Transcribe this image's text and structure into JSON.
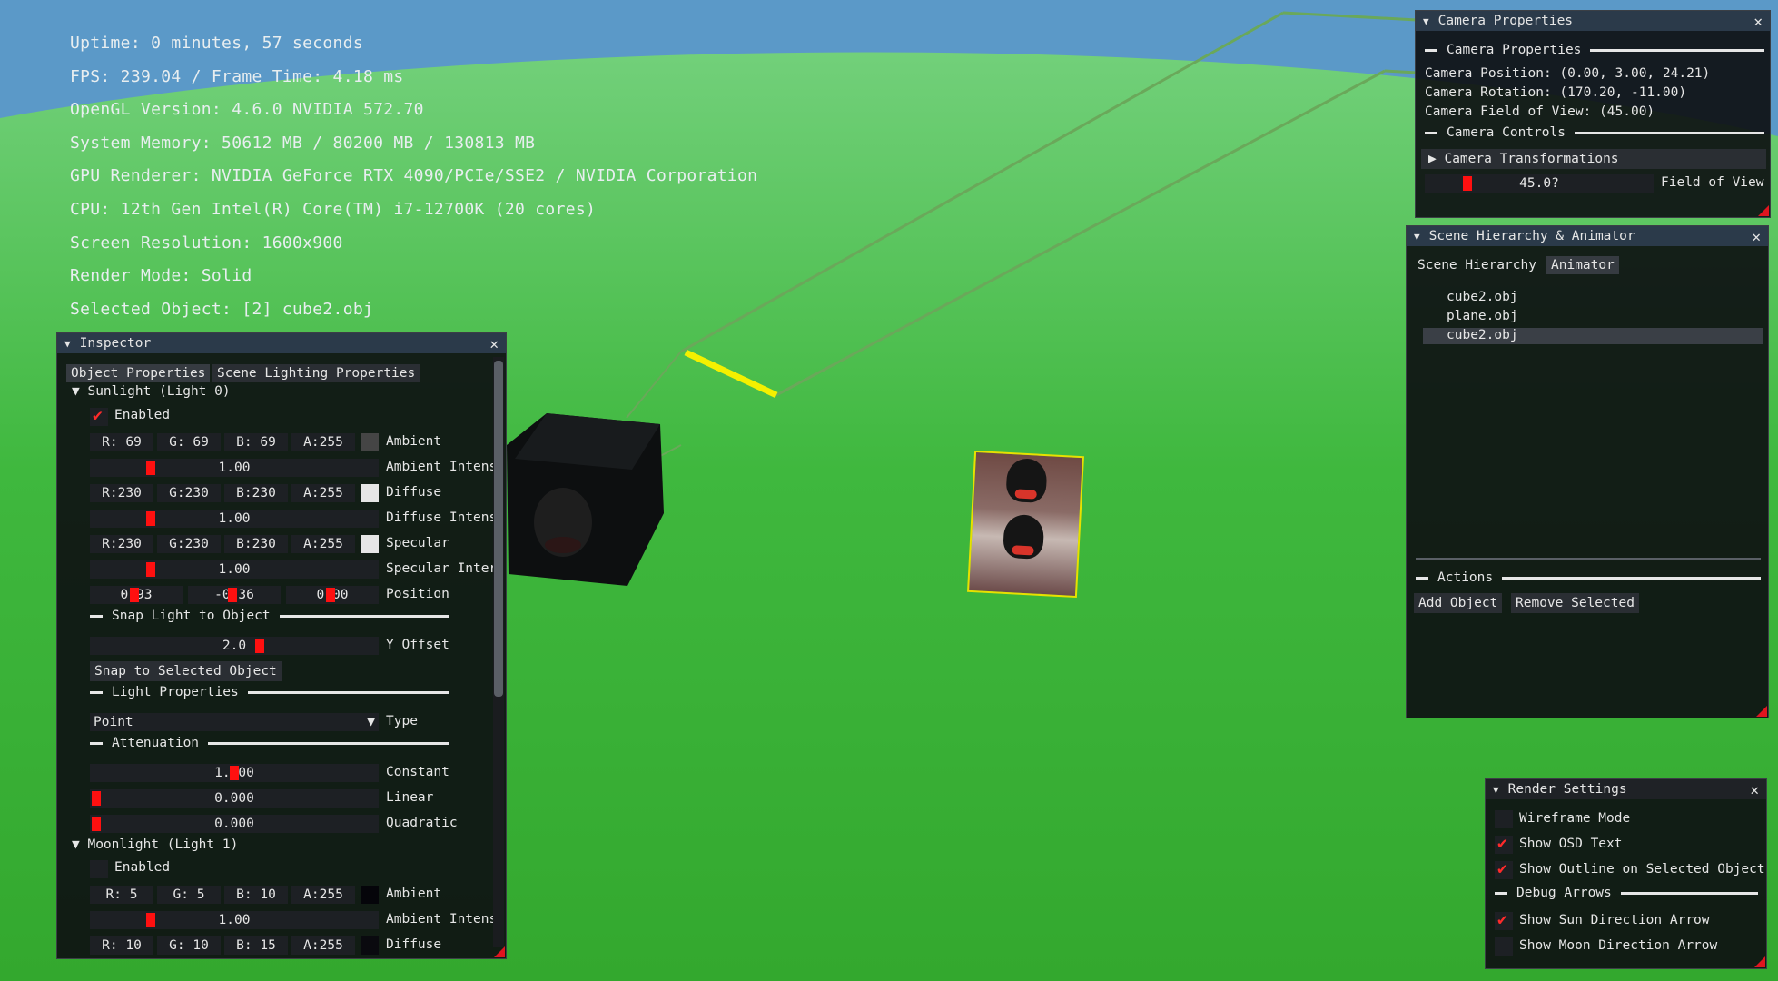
{
  "osd": {
    "lines": [
      "Uptime: 0 minutes, 57 seconds",
      "FPS: 239.04 / Frame Time: 4.18 ms",
      "OpenGL Version: 4.6.0 NVIDIA 572.70",
      "System Memory: 50612 MB / 80200 MB / 130813 MB",
      "GPU Renderer: NVIDIA GeForce RTX 4090/PCIe/SSE2 / NVIDIA Corporation",
      "CPU: 12th Gen Intel(R) Core(TM) i7-12700K (20 cores)",
      "Screen Resolution: 1600x900",
      "Render Mode: Solid",
      "Selected Object: [2] cube2.obj"
    ]
  },
  "colors": {
    "sky": "#5b99c8",
    "ground": "#3cb83c",
    "accent_red": "#ff1010",
    "outline_yellow": "#e8e000",
    "title_active": "#2b3a4a"
  },
  "inspector": {
    "title": "Inspector",
    "tabs": [
      "Object Properties",
      "Scene Lighting Properties"
    ],
    "sun": {
      "header": "Sunlight (Light 0)",
      "enabled_label": "Enabled",
      "enabled": true,
      "ambient": {
        "r": "R: 69",
        "g": "G: 69",
        "b": "B: 69",
        "a": "A:255",
        "label": "Ambient",
        "swatch": "#454545"
      },
      "ambient_intensity": {
        "value": "1.00",
        "label": "Ambient Intens"
      },
      "diffuse": {
        "r": "R:230",
        "g": "G:230",
        "b": "B:230",
        "a": "A:255",
        "label": "Diffuse",
        "swatch": "#e6e6e6"
      },
      "diffuse_intensity": {
        "value": "1.00",
        "label": "Diffuse Intens"
      },
      "specular": {
        "r": "R:230",
        "g": "G:230",
        "b": "B:230",
        "a": "A:255",
        "label": "Specular",
        "swatch": "#e6e6e6"
      },
      "specular_intensity": {
        "value": "1.00",
        "label": "Specular Inter"
      },
      "position": {
        "x": "0.93",
        "y": "-0.36",
        "z": "0.00",
        "label": "Position"
      },
      "snap_header": "Snap Light to Object",
      "y_offset": {
        "value": "2.0",
        "label": "Y Offset"
      },
      "snap_button": "Snap to Selected Object",
      "light_props_header": "Light Properties",
      "type": {
        "value": "Point",
        "label": "Type"
      },
      "attenuation_header": "Attenuation",
      "constant": {
        "value": "1.000",
        "label": "Constant"
      },
      "linear": {
        "value": "0.000",
        "label": "Linear"
      },
      "quadratic": {
        "value": "0.000",
        "label": "Quadratic"
      }
    },
    "moon": {
      "header": "Moonlight (Light 1)",
      "enabled_label": "Enabled",
      "enabled": false,
      "ambient": {
        "r": "R: 5",
        "g": "G: 5",
        "b": "B: 10",
        "a": "A:255",
        "label": "Ambient",
        "swatch": "#05050a"
      },
      "ambient_intensity": {
        "value": "1.00",
        "label": "Ambient Intens"
      },
      "diffuse": {
        "r": "R: 10",
        "g": "G: 10",
        "b": "B: 15",
        "a": "A:255",
        "label": "Diffuse",
        "swatch": "#0a0a0f"
      }
    }
  },
  "camera": {
    "title": "Camera Properties",
    "section": "Camera Properties",
    "position": "Camera Position: (0.00, 3.00, 24.21)",
    "rotation": "Camera Rotation: (170.20, -11.00)",
    "fov": "Camera Field of View: (45.00)",
    "controls": "Camera Controls",
    "transformations": "Camera Transformations",
    "fov_slider": {
      "value": "45.0?",
      "label": "Field of View"
    }
  },
  "scene": {
    "title": "Scene Hierarchy & Animator",
    "tabs": [
      "Scene Hierarchy",
      "Animator"
    ],
    "items": [
      "cube2.obj",
      "plane.obj",
      "cube2.obj"
    ],
    "actions_header": "Actions",
    "add_button": "Add Object",
    "remove_button": "Remove Selected"
  },
  "render": {
    "title": "Render Settings",
    "wireframe": {
      "label": "Wireframe Mode",
      "checked": false
    },
    "osd": {
      "label": "Show OSD Text",
      "checked": true
    },
    "outline": {
      "label": "Show Outline on Selected Object",
      "checked": true
    },
    "debug_header": "Debug Arrows",
    "sun_arrow": {
      "label": "Show Sun Direction Arrow",
      "checked": true
    },
    "moon_arrow": {
      "label": "Show Moon Direction Arrow",
      "checked": false
    }
  }
}
